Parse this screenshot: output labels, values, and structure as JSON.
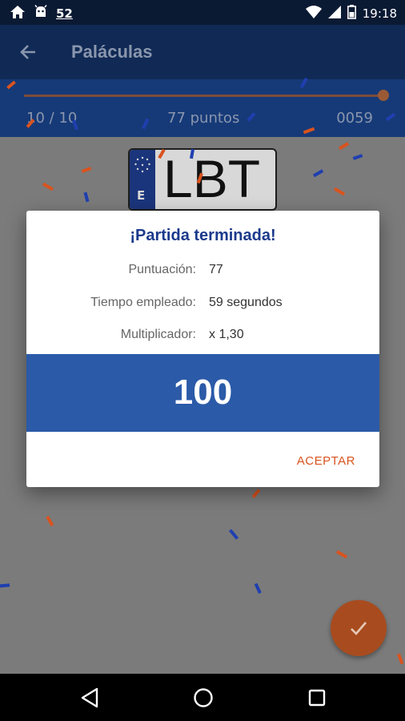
{
  "status_bar": {
    "left_icons": [
      "home-icon",
      "android-icon"
    ],
    "notification_count": "52",
    "right_icons": [
      "wifi-icon",
      "signal-icon",
      "battery-icon"
    ],
    "time": "19:18"
  },
  "app_bar": {
    "back_icon": "arrow-left-icon",
    "title": "Paláculas"
  },
  "progress": {
    "counter": "10 / 10",
    "points": "77 puntos",
    "timer": "0059",
    "fraction": 1.0
  },
  "plate": {
    "country": "E",
    "text": "LBT"
  },
  "dialog": {
    "title": "¡Partida terminada!",
    "rows": [
      {
        "label": "Puntuación:",
        "value": "77"
      },
      {
        "label": "Tiempo empleado:",
        "value": "59 segundos"
      },
      {
        "label": "Multiplicador:",
        "value": "x 1,30"
      }
    ],
    "final_score": "100",
    "accept_label": "ACEPTAR"
  },
  "fab": {
    "icon": "check-icon"
  },
  "nav": {
    "icons": [
      "nav-back-icon",
      "nav-home-icon",
      "nav-recent-icon"
    ]
  },
  "colors": {
    "primary": "#102a55",
    "progress_bg": "#163a78",
    "score_bg": "#2b5aa8",
    "accent": "#d9531e",
    "confetti_blue": "#1f3fb0",
    "confetti_orange": "#d9531e"
  }
}
